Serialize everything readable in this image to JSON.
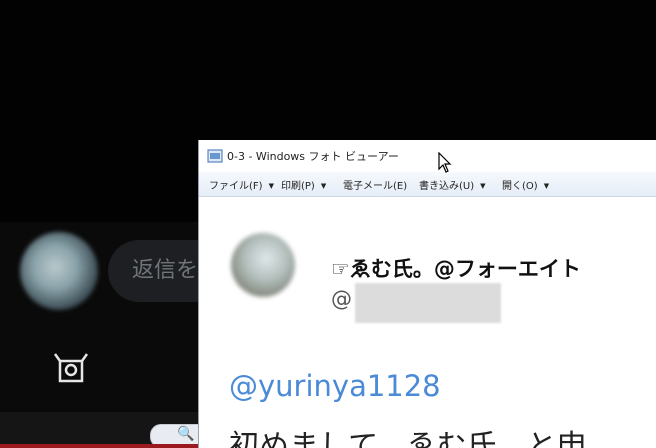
{
  "background_app": {
    "reply_placeholder": "返信を",
    "search_glyph": "🔍",
    "icons": {
      "camera": "camera-icon"
    }
  },
  "viewer": {
    "title": "0-3 - Windows フォト ビューアー",
    "menu": [
      {
        "label": "ファイル(F)"
      },
      {
        "label": "印刷(P)"
      },
      {
        "label": "電子メール(E)"
      },
      {
        "label": "書き込み(U)"
      },
      {
        "label": "開く(O)"
      }
    ],
    "caret": "▼",
    "tweet": {
      "display_name": "☞ゑむ氏。@フォーエイト",
      "handle_prefix": "@",
      "reply_to": "@yurinya1128",
      "text": "初めまして、ゑむ氏、と申"
    }
  },
  "colors": {
    "link": "#4b8ad6",
    "bottom_accent": "#9b1a20"
  }
}
